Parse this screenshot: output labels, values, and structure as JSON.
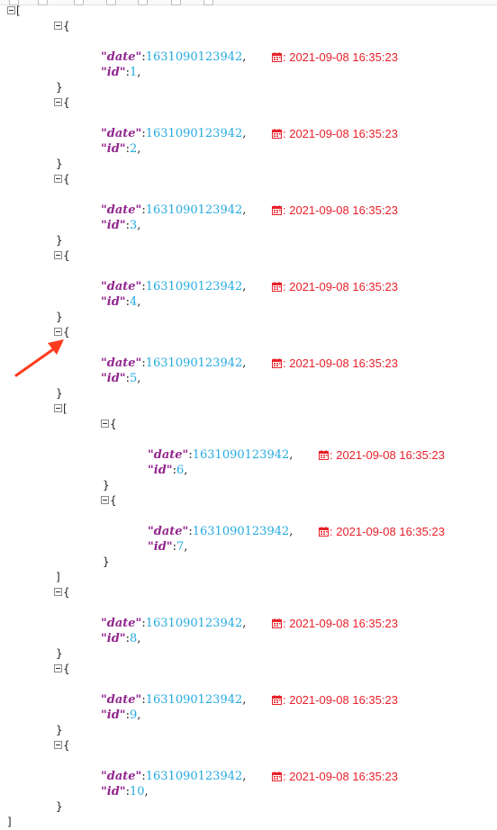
{
  "root": {
    "open": "[",
    "close": "]",
    "entries": [
      {
        "kind": "obj",
        "date_key": "\"date\"",
        "date_val": "1631090123942",
        "date_readable": ": 2021-09-08 16:35:23",
        "id_key": "\"id\"",
        "id_val": "1"
      },
      {
        "kind": "obj",
        "date_key": "\"date\"",
        "date_val": "1631090123942",
        "date_readable": ": 2021-09-08 16:35:23",
        "id_key": "\"id\"",
        "id_val": "2"
      },
      {
        "kind": "obj",
        "date_key": "\"date\"",
        "date_val": "1631090123942",
        "date_readable": ": 2021-09-08 16:35:23",
        "id_key": "\"id\"",
        "id_val": "3"
      },
      {
        "kind": "obj",
        "date_key": "\"date\"",
        "date_val": "1631090123942",
        "date_readable": ": 2021-09-08 16:35:23",
        "id_key": "\"id\"",
        "id_val": "4"
      },
      {
        "kind": "obj",
        "date_key": "\"date\"",
        "date_val": "1631090123942",
        "date_readable": ": 2021-09-08 16:35:23",
        "id_key": "\"id\"",
        "id_val": "5"
      },
      {
        "kind": "arr",
        "open": "[",
        "close": "]",
        "children": [
          {
            "kind": "obj",
            "date_key": "\"date\"",
            "date_val": "1631090123942",
            "date_readable": ": 2021-09-08 16:35:23",
            "id_key": "\"id\"",
            "id_val": "6"
          },
          {
            "kind": "obj",
            "date_key": "\"date\"",
            "date_val": "1631090123942",
            "date_readable": ": 2021-09-08 16:35:23",
            "id_key": "\"id\"",
            "id_val": "7"
          }
        ]
      },
      {
        "kind": "obj",
        "date_key": "\"date\"",
        "date_val": "1631090123942",
        "date_readable": ": 2021-09-08 16:35:23",
        "id_key": "\"id\"",
        "id_val": "8"
      },
      {
        "kind": "obj",
        "date_key": "\"date\"",
        "date_val": "1631090123942",
        "date_readable": ": 2021-09-08 16:35:23",
        "id_key": "\"id\"",
        "id_val": "9"
      },
      {
        "kind": "obj",
        "date_key": "\"date\"",
        "date_val": "1631090123942",
        "date_readable": ": 2021-09-08 16:35:23",
        "id_key": "\"id\"",
        "id_val": "10"
      }
    ]
  },
  "colors": {
    "key": "#92278f",
    "number": "#25aae1",
    "date_readable": "#e8202a",
    "annotation_arrow": "#ff3b1f"
  },
  "icons": {
    "toggle": "collapse-toggle-icon",
    "calendar": "calendar-icon",
    "annotation": "red-arrow-annotation"
  }
}
